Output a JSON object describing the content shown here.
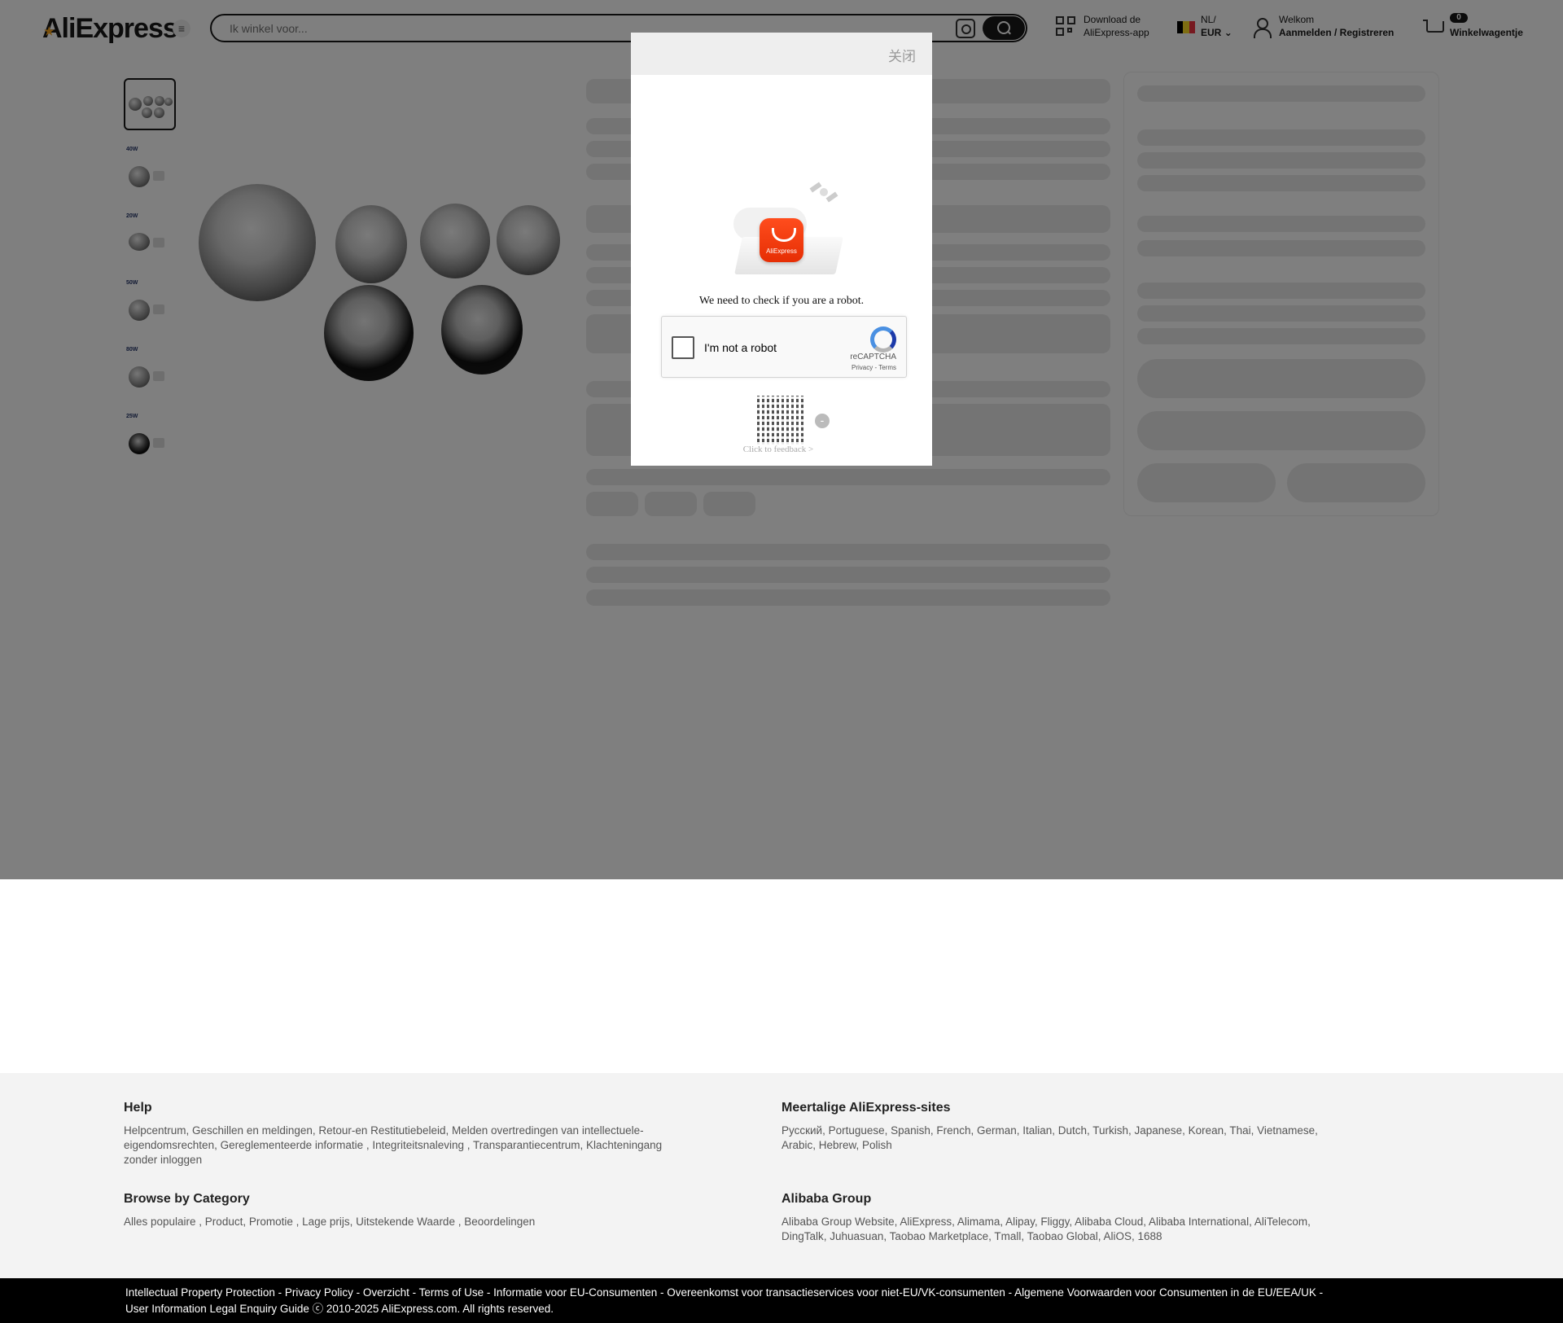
{
  "header": {
    "logo": "AliExpress",
    "search_placeholder": "Ik winkel voor...",
    "app_line1": "Download de",
    "app_line2": "AliExpress-app",
    "lang": "NL/",
    "currency": "EUR",
    "welcome": "Welkom",
    "signin": "Aanmelden / Registreren",
    "cart_count": "0",
    "cart_label": "Winkelwagentje"
  },
  "gallery": {
    "thumb_labels": [
      "",
      "40W",
      "20W",
      "50W",
      "80W",
      "25W"
    ]
  },
  "captcha": {
    "close_label": "关闭",
    "app_icon_text": "AliExpress",
    "message": "We need to check if you are a robot.",
    "checkbox_label": "I'm not a robot",
    "brand": "reCAPTCHA",
    "links": "Privacy - Terms",
    "minimize_symbol": "-",
    "feedback": "Click to feedback >"
  },
  "footer": {
    "help_title": "Help",
    "help_text": "Helpcentrum, Geschillen en meldingen, Retour-en Restitutiebeleid, Melden overtredingen van intellectuele-eigendomsrechten, Gereglementeerde informatie , Integriteitsnaleving , Transparantiecentrum, Klachteningang zonder inloggen",
    "sites_title": "Meertalige AliExpress-sites",
    "sites_text": "Русский, Portuguese, Spanish, French, German, Italian, Dutch, Turkish, Japanese, Korean, Thai, Vietnamese, Arabic, Hebrew, Polish",
    "browse_title": "Browse by Category",
    "browse_text": "Alles populaire , Product, Promotie , Lage prijs, Uitstekende Waarde , Beoordelingen",
    "group_title": "Alibaba Group",
    "group_text": "Alibaba Group Website, AliExpress, Alimama, Alipay, Fliggy, Alibaba Cloud, Alibaba International, AliTelecom, DingTalk, Juhuasuan, Taobao Marketplace, Tmall, Taobao Global, AliOS, 1688",
    "bottom_line1": "Intellectual Property Protection  -  Privacy Policy  -  Overzicht  -  Terms of Use  -  Informatie voor EU-Consumenten  -  Overeenkomst voor transactieservices voor niet-EU/VK-consumenten  -  Algemene Voorwaarden voor Consumenten in de EU/EEA/UK  -",
    "bottom_line2": "User Information Legal Enquiry Guide  ⓒ 2010-2025 AliExpress.com. All rights reserved."
  },
  "colors": {
    "accent": "#e62e04",
    "overlay": "rgba(0,0,0,0.5)",
    "dark": "#191919"
  }
}
